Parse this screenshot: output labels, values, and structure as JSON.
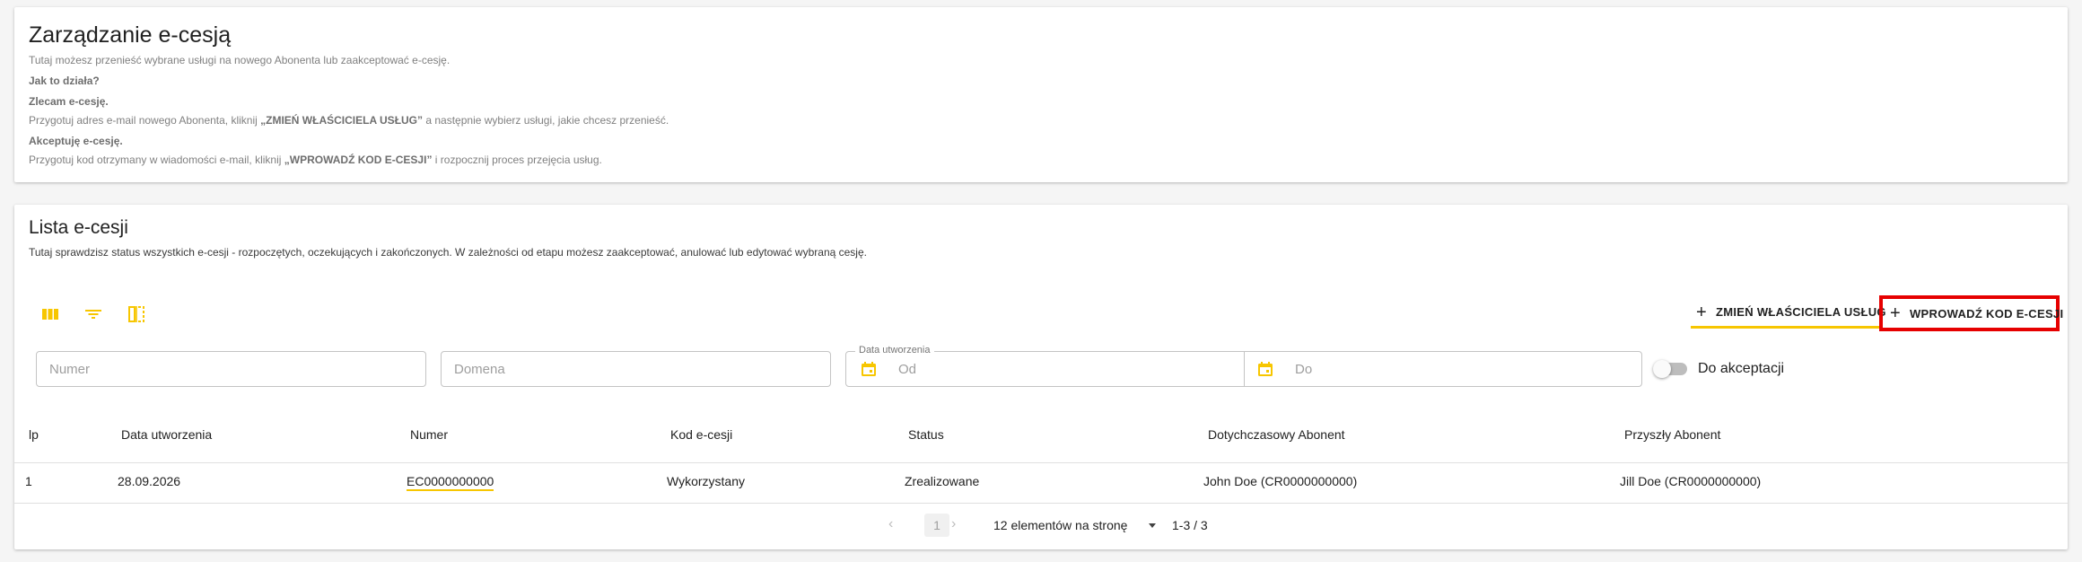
{
  "header": {
    "title": "Zarządzanie e-cesją",
    "subtitle": "Tutaj możesz przenieść wybrane usługi na nowego Abonenta lub zaakceptować e-cesję.",
    "how_title": "Jak to działa?",
    "order_title": "Zlecam e-cesję.",
    "order_text_pre": "Przygotuj adres e-mail nowego Abonenta, kliknij ",
    "order_text_hl": "„ZMIEŃ WŁAŚCICIELA USŁUG”",
    "order_text_post": " a następnie wybierz usługi, jakie chcesz przenieść.",
    "accept_title": "Akceptuję e-cesję.",
    "accept_text_pre": "Przygotuj kod otrzymany w wiadomości e-mail, kliknij ",
    "accept_text_hl": "„WPROWADŹ KOD E-CESJI”",
    "accept_text_post": " i rozpocznij proces przejęcia usług."
  },
  "list": {
    "title": "Lista e-cesji",
    "description": "Tutaj sprawdzisz status wszystkich e-cesji - rozpoczętych, oczekujących i zakończonych. W zależności od etapu możesz zaakceptować, anulować lub edytować wybraną cesję.",
    "buttons": {
      "change_owner": "ZMIEŃ WŁAŚCICIELA USŁUG",
      "enter_code": "WPROWADŹ KOD E-CESJI",
      "plus": "+"
    },
    "filters": {
      "number_placeholder": "Numer",
      "domain_placeholder": "Domena",
      "date_legend": "Data utworzenia",
      "from_placeholder": "Od",
      "to_placeholder": "Do",
      "toggle_label": "Do akceptacji"
    },
    "columns": [
      "lp",
      "Data utworzenia",
      "Numer",
      "Kod e-cesji",
      "Status",
      "Dotychczasowy Abonent",
      "Przyszły Abonent"
    ],
    "rows": [
      [
        "1",
        "28.09.2026",
        "EC0000000000",
        "Wykorzystany",
        "Zrealizowane",
        "John Doe (CR0000000000)",
        "Jill Doe (CR0000000000)"
      ]
    ],
    "paginator": {
      "prev": "‹",
      "page": "1",
      "next": "›",
      "per_page": "12 elementów na stronę",
      "range": "1-3 / 3"
    }
  },
  "colors": {
    "accent": "#f7c600",
    "highlight_border": "#e60000"
  }
}
